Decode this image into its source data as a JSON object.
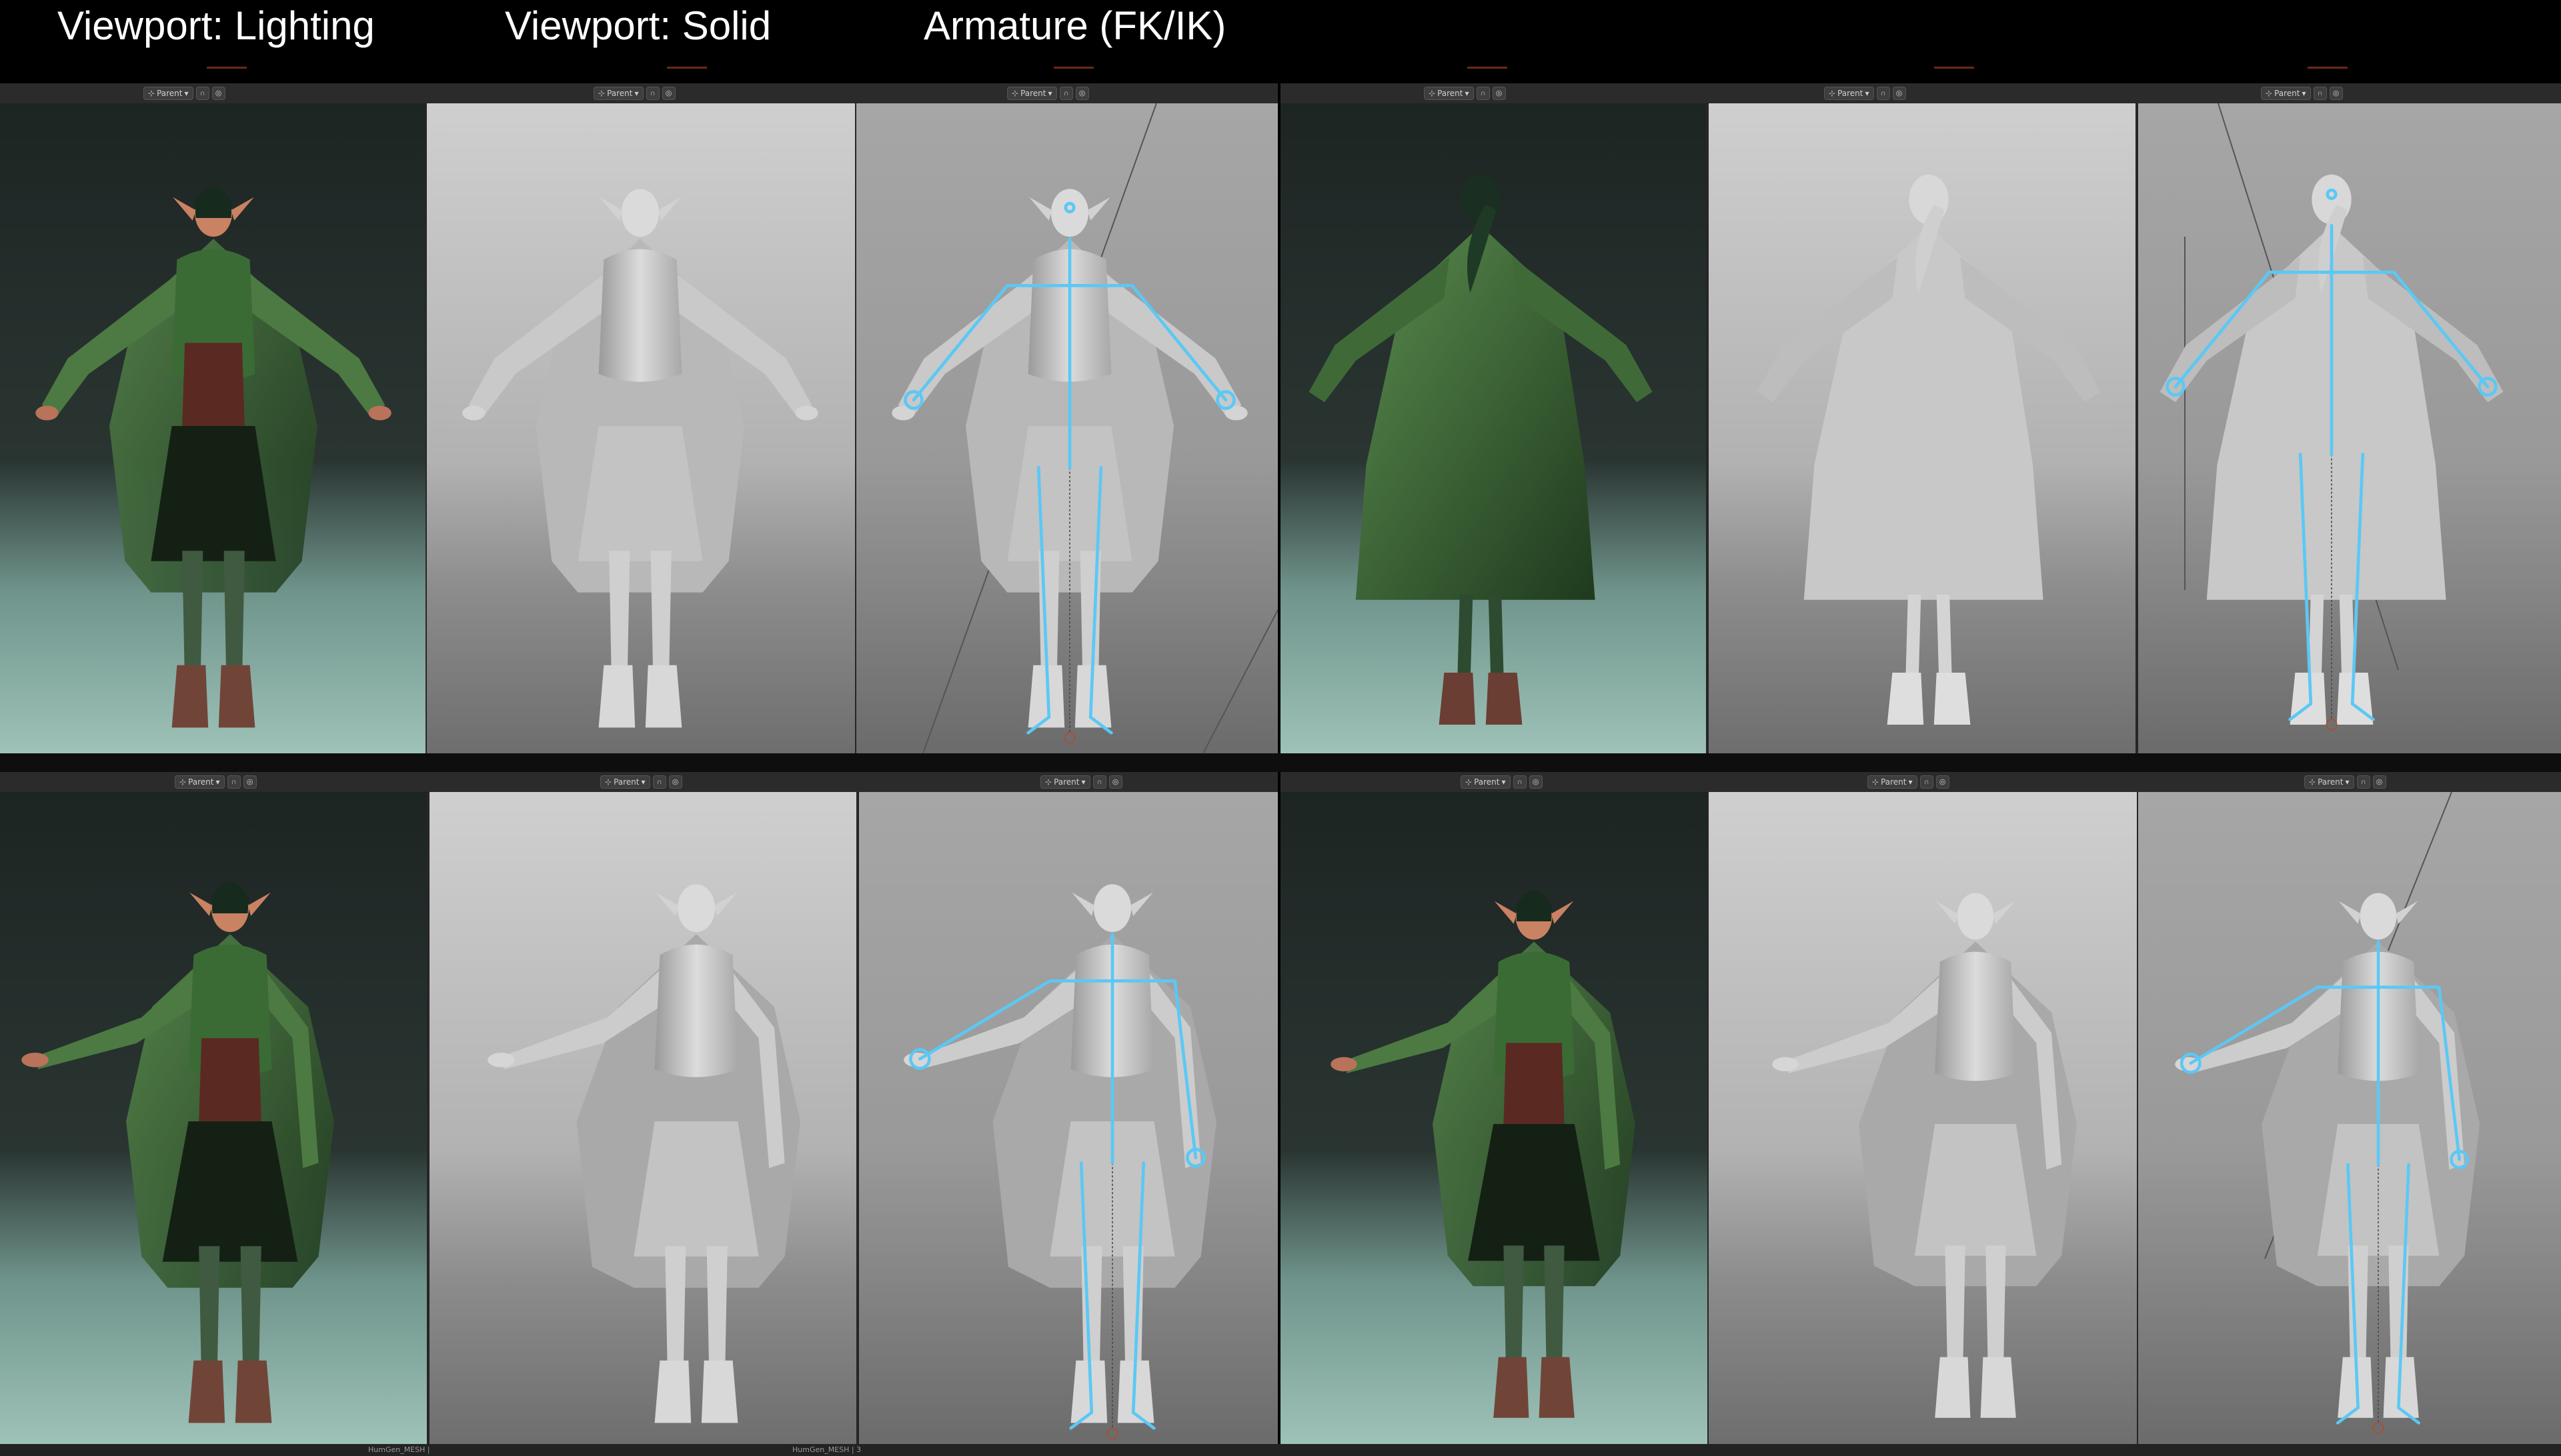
{
  "headers": {
    "lighting": "Viewport: Lighting",
    "solid": "Viewport: Solid",
    "armature": "Armature (FK/IK)"
  },
  "toolbar": {
    "transform_pivot": "Parent",
    "pivot_icon": "pivot-icon",
    "snap_icon": "magnet-icon",
    "proportional_icon": "proportional-edit-icon"
  },
  "footer": {
    "left_label": "HumGen_MESH |",
    "right_label": "HumGen_MESH | 3"
  },
  "colors": {
    "bone": "#5bc8f5",
    "cloak": "#3d6b38",
    "skin": "#c98262",
    "solid_mesh": "#d2d2d2",
    "lighting_bg": "#1e2624",
    "lighting_floor": "#7ea89e",
    "solid_bg": "#b5b5b5",
    "solid_floor": "#7a7a7a"
  }
}
